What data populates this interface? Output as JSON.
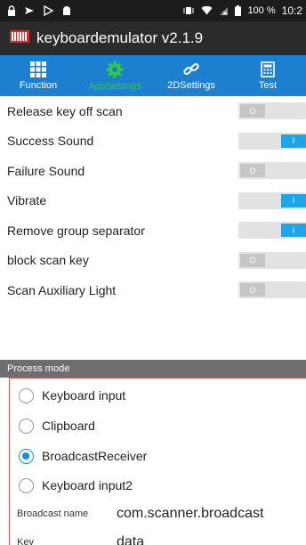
{
  "status_bar": {
    "battery": "100 %",
    "time": "10:2"
  },
  "app": {
    "title": "keyboardemulator v2.1.9"
  },
  "tabs": [
    {
      "label": "Function",
      "icon": "grid-icon",
      "active": false
    },
    {
      "label": "AppSettings",
      "icon": "gear-icon",
      "active": true
    },
    {
      "label": "2DSettings",
      "icon": "link-icon",
      "active": false
    },
    {
      "label": "Test",
      "icon": "calculator-icon",
      "active": false
    }
  ],
  "settings": [
    {
      "label": "Release key off scan",
      "state": "O",
      "on": false
    },
    {
      "label": "Success Sound",
      "state": "I",
      "on": true
    },
    {
      "label": "Failure Sound",
      "state": "O",
      "on": false
    },
    {
      "label": "Vibrate",
      "state": "I",
      "on": true
    },
    {
      "label": "Remove group separator",
      "state": "I",
      "on": true
    },
    {
      "label": "block scan key",
      "state": "O",
      "on": false
    },
    {
      "label": "Scan Auxiliary Light",
      "state": "O",
      "on": false
    }
  ],
  "process_mode": {
    "header": "Process mode",
    "options": [
      {
        "label": "Keyboard input",
        "checked": false
      },
      {
        "label": "Clipboard",
        "checked": false
      },
      {
        "label": "BroadcastReceiver",
        "checked": true
      },
      {
        "label": "Keyboard input2",
        "checked": false
      }
    ],
    "broadcast_name_label": "Broadcast name",
    "broadcast_name_value": "com.scanner.broadcast",
    "key_label": "Key",
    "key_value": "data"
  },
  "colors": {
    "tab_bar": "#1c7fd0",
    "active_tab": "#2ecc40",
    "toggle_on": "#1ea5e8",
    "frame": "#e05050",
    "app_bar": "#2b2b2b"
  }
}
